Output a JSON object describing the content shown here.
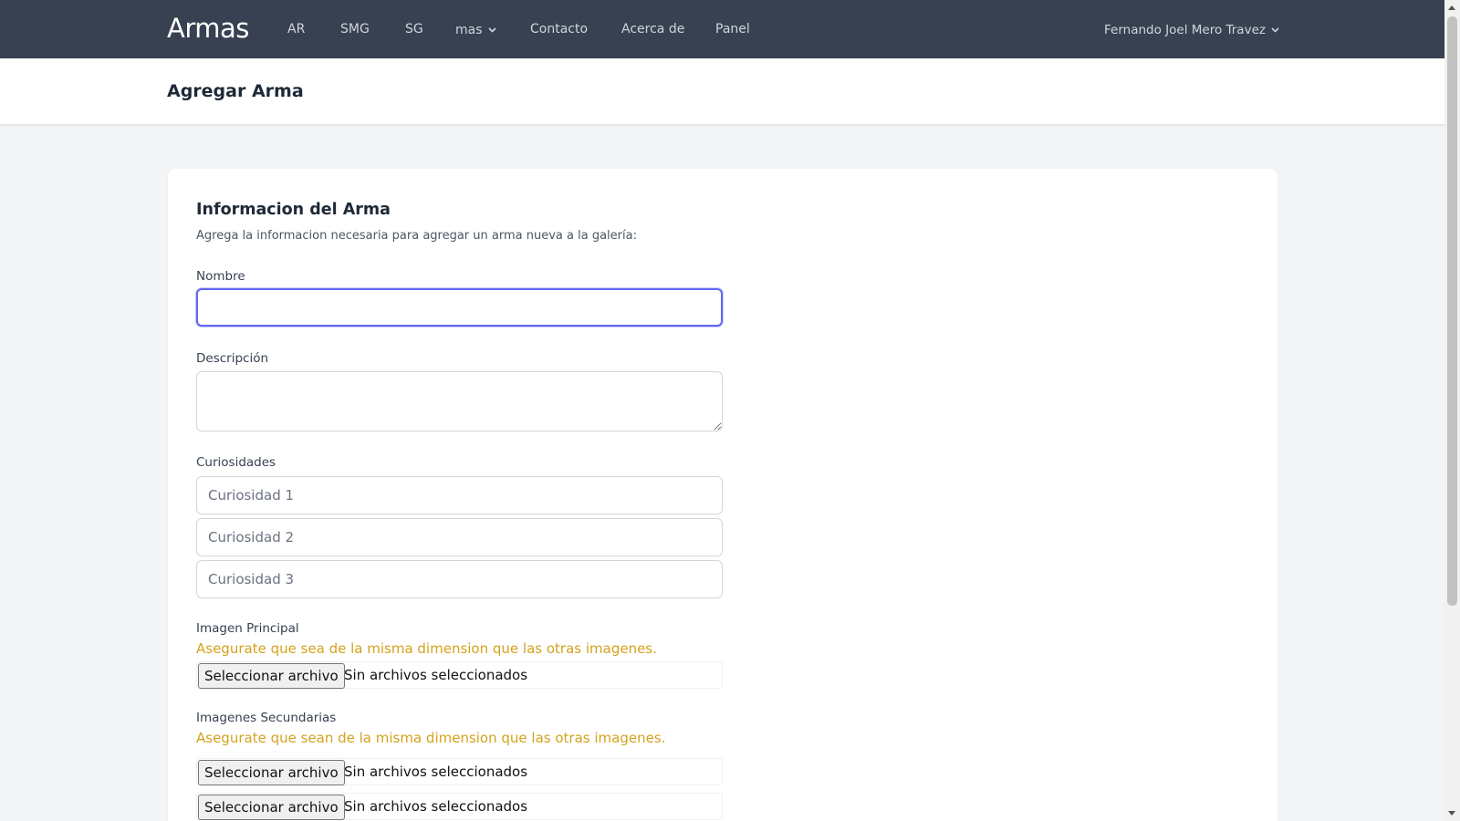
{
  "nav": {
    "brand": "Armas",
    "items": [
      "AR",
      "SMG",
      "SG",
      "mas",
      "Contacto",
      "Acerca de",
      "Panel"
    ],
    "user_name": "Fernando Joel Mero Travez"
  },
  "header": {
    "title": "Agregar Arma"
  },
  "form": {
    "section_title": "Informacion del Arma",
    "section_subtitle": "Agrega la informacion necesaria para agregar un arma nueva a la galería:",
    "nombre_label": "Nombre",
    "nombre_value": "",
    "descripcion_label": "Descripción",
    "curiosidades_label": "Curiosidades",
    "curiosidad_placeholders": [
      "Curiosidad 1",
      "Curiosidad 2",
      "Curiosidad 3"
    ],
    "imagen_principal_label": "Imagen Principal",
    "imagen_principal_warning": "Asegurate que sea de la misma dimension que las otras imagenes.",
    "imagenes_secundarias_label": "Imagenes Secundarias",
    "imagenes_secundarias_warning": "Asegurate que sean de la misma dimension que las otras imagenes.",
    "file_button_label": "Seleccionar archivo",
    "file_status": "Sin archivos seleccionados"
  }
}
